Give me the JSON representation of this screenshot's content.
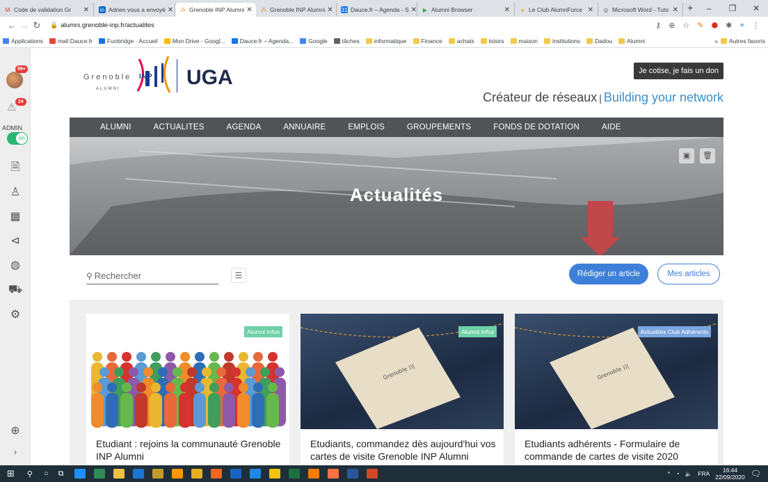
{
  "browser": {
    "tabs": [
      {
        "label": "Code de validation Gr",
        "color": "#d93025"
      },
      {
        "label": "Adrien vous a envoyé",
        "color": "#0a66c2"
      },
      {
        "label": "Grenoble INP Alumni",
        "color": "#e0a030",
        "active": true
      },
      {
        "label": "Grenoble INP Alumni",
        "color": "#e0a030"
      },
      {
        "label": "Dauce.fr – Agenda - S",
        "color": "#1a73e8"
      },
      {
        "label": "Alumni Browser",
        "color": "#34a853"
      },
      {
        "label": "Le Club AlumnForce",
        "color": "#f4b400"
      },
      {
        "label": "Microsoft Word - Tuto",
        "color": "#5f6368"
      }
    ],
    "new_tab": "+",
    "controls": {
      "minimize": "–",
      "maximize": "❐",
      "close": "✕"
    },
    "url": "alumni.grenoble-inp.fr/actualites",
    "bookmarks": [
      {
        "label": "Applications",
        "color": "#4285f4"
      },
      {
        "label": "mail Dauce.fr",
        "color": "#ea4335"
      },
      {
        "label": "Funbridge - Accueil",
        "color": "#1a73e8"
      },
      {
        "label": "Mon Drive - Googl...",
        "color": "#fbbc04"
      },
      {
        "label": "Dauce.fr – Agenda...",
        "color": "#1a73e8"
      },
      {
        "label": "Google",
        "color": "#4285f4"
      },
      {
        "label": "tâches",
        "color": "#5f6368"
      },
      {
        "label": "informatique",
        "folder": true
      },
      {
        "label": "Finance",
        "folder": true
      },
      {
        "label": "achats",
        "folder": true
      },
      {
        "label": "loisirs",
        "folder": true
      },
      {
        "label": "maison",
        "folder": true
      },
      {
        "label": "institutions",
        "folder": true
      },
      {
        "label": "Dadou",
        "folder": true
      },
      {
        "label": "Alumni",
        "folder": true
      }
    ],
    "bookmarks_more": "»",
    "other_bookmarks": "Autres favoris"
  },
  "sidebar": {
    "notifications_badge": "99+",
    "alerts_badge": "24",
    "admin_label": "ADMIN",
    "toggle_label": "on"
  },
  "site": {
    "logo_text": "Grenoble",
    "logo_inp": "INP",
    "logo_sub": "ALUMNI",
    "uga": "UGA",
    "donate_button": "Je cotise, je fais un don",
    "tagline_fr": "Créateur de réseaux",
    "tagline_sep": "|",
    "tagline_en": "Building your network",
    "nav": [
      "ALUMNI",
      "ACTUALITES",
      "AGENDA",
      "ANNUAIRE",
      "EMPLOIS",
      "GROUPEMENTS",
      "FONDS DE DOTATION",
      "AIDE"
    ],
    "hero_title": "Actualités",
    "search_placeholder": "Rechercher",
    "write_article": "Rédiger un article",
    "my_articles": "Mes articles",
    "cards": [
      {
        "badge": "Alumni Infos",
        "badge_color": "#6ed1a8",
        "title": "Etudiant : rejoins la communauté Grenoble INP Alumni"
      },
      {
        "badge": "Alumni Infos",
        "badge_color": "#6ed1a8",
        "title": "Etudiants, commandez dès aujourd'hui vos cartes de visite Grenoble INP Alumni"
      },
      {
        "badge": "Actualités Club Adhérents",
        "badge_color": "#7aa6e0",
        "title": "Etudiants adhérents - Formulaire de commande de cartes de visite 2020"
      }
    ]
  },
  "taskbar": {
    "time": "16:44",
    "date": "22/09/2020",
    "lang": "FRA",
    "notif_count": "9"
  }
}
